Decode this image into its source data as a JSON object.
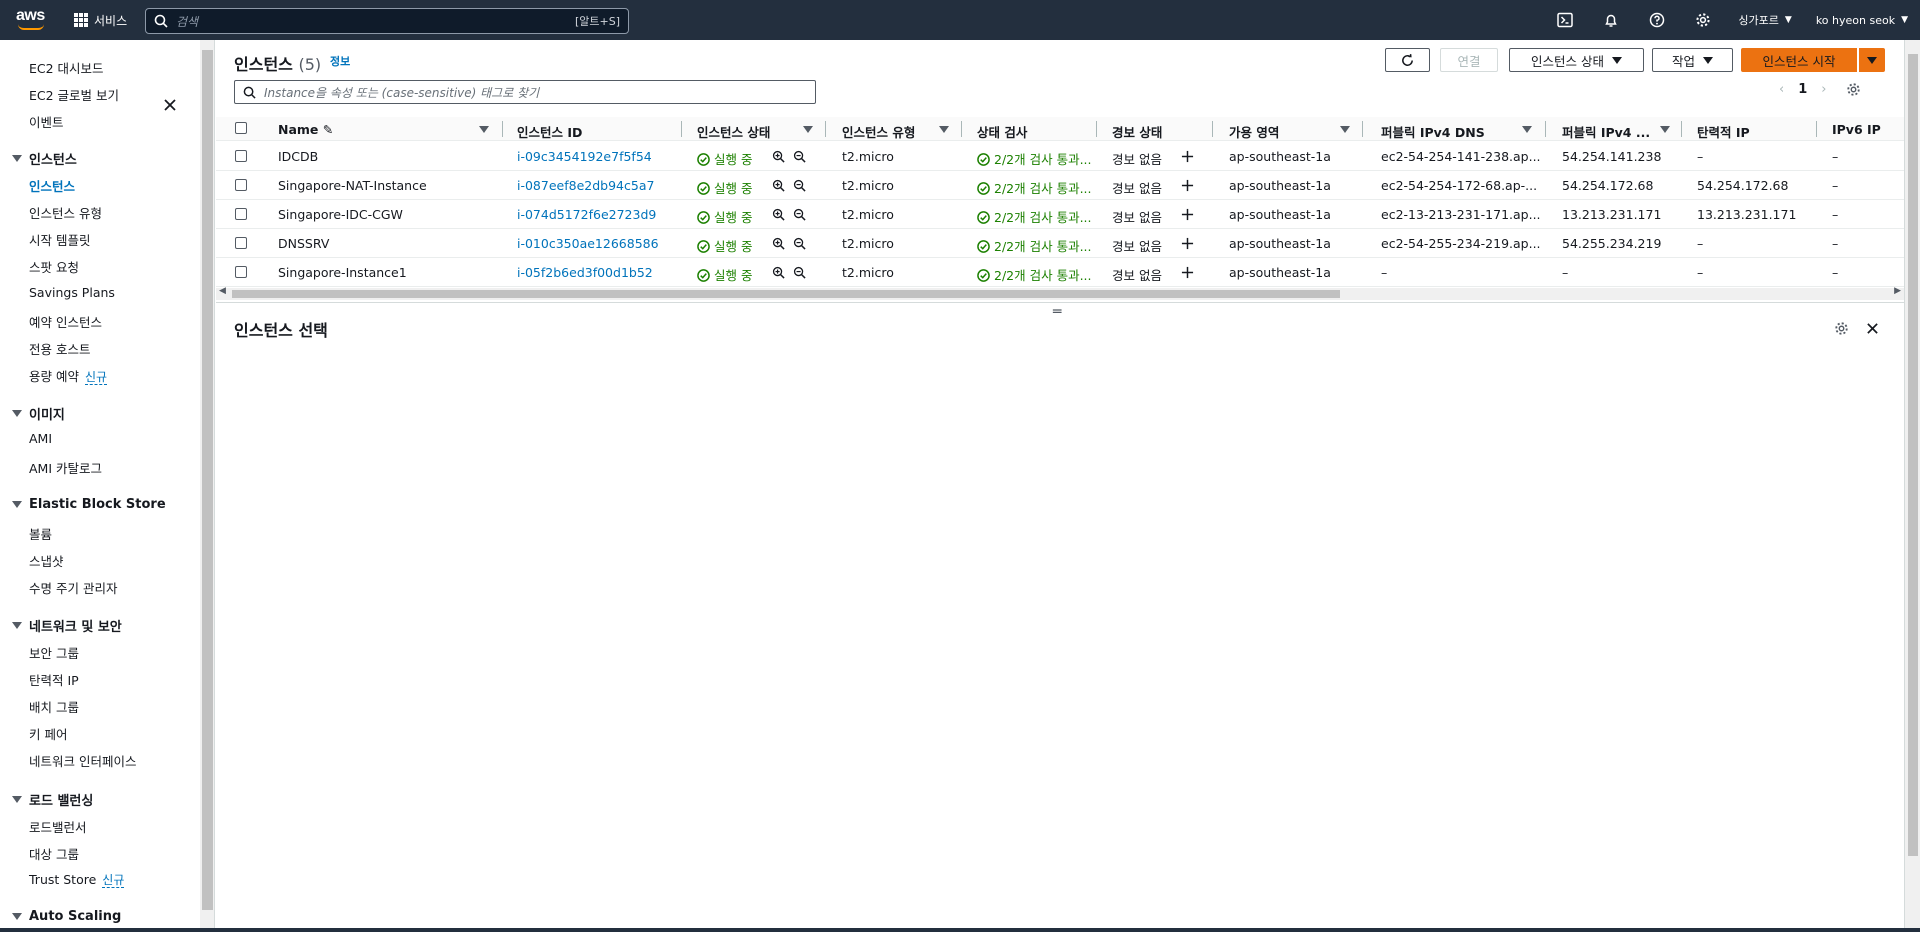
{
  "topnav": {
    "logo": "aws",
    "services_label": "서비스",
    "search_placeholder": "검색",
    "search_shortcut": "[알트+S]",
    "region": "싱가포르",
    "user": "ko hyeon seok",
    "icons": [
      "cloudshell-icon",
      "bell-icon",
      "help-icon",
      "gear-icon"
    ]
  },
  "sidebar": {
    "top_items": [
      "EC2 대시보드",
      "EC2 글로벌 보기",
      "이벤트"
    ],
    "sections": [
      {
        "title": "인스턴스",
        "items": [
          "인스턴스",
          "인스턴스 유형",
          "시작 템플릿",
          "스팟 요청",
          "Savings Plans",
          "예약 인스턴스",
          "전용 호스트",
          "용량 예약"
        ],
        "new_badge_on": "용량 예약"
      },
      {
        "title": "이미지",
        "items": [
          "AMI",
          "AMI 카탈로그"
        ]
      },
      {
        "title": "Elastic Block Store",
        "items": [
          "볼륨",
          "스냅샷",
          "수명 주기 관리자"
        ]
      },
      {
        "title": "네트워크 및 보안",
        "items": [
          "보안 그룹",
          "탄력적 IP",
          "배치 그룹",
          "키 페어",
          "네트워크 인터페이스"
        ]
      },
      {
        "title": "로드 밸런싱",
        "items": [
          "로드밸런서",
          "대상 그룹",
          "Trust Store"
        ],
        "new_badge_on": "Trust Store"
      },
      {
        "title": "Auto Scaling",
        "items": []
      }
    ],
    "new_label": "신규",
    "active_item": "인스턴스"
  },
  "header": {
    "title": "인스턴스",
    "count": "(5)",
    "info": "정보",
    "buttons": {
      "connect": "연결",
      "instance_state": "인스턴스 상태",
      "actions": "작업",
      "launch": "인스턴스 시작"
    },
    "filter_placeholder": "Instance을 속성 또는 (case-sensitive) 태그로 찾기",
    "page": "1"
  },
  "table": {
    "columns": [
      "Name",
      "인스턴스 ID",
      "인스턴스 상태",
      "인스턴스 유형",
      "상태 검사",
      "경보 상태",
      "가용 영역",
      "퍼블릭 IPv4 DNS",
      "퍼블릭 IPv4 ...",
      "탄력적 IP",
      "IPv6 IP"
    ],
    "rows": [
      {
        "name": "IDCDB",
        "id": "i-09c3454192e7f5f54",
        "state": "실행 중",
        "type": "t2.micro",
        "check": "2/2개 검사 통과...",
        "alarm": "경보 없음",
        "az": "ap-southeast-1a",
        "dns": "ec2-54-254-141-238.ap...",
        "ipv4": "54.254.141.238",
        "eip": "–",
        "ipv6": "–"
      },
      {
        "name": "Singapore-NAT-Instance",
        "id": "i-087eef8e2db94c5a7",
        "state": "실행 중",
        "type": "t2.micro",
        "check": "2/2개 검사 통과...",
        "alarm": "경보 없음",
        "az": "ap-southeast-1a",
        "dns": "ec2-54-254-172-68.ap-...",
        "ipv4": "54.254.172.68",
        "eip": "54.254.172.68",
        "ipv6": "–"
      },
      {
        "name": "Singapore-IDC-CGW",
        "id": "i-074d5172f6e2723d9",
        "state": "실행 중",
        "type": "t2.micro",
        "check": "2/2개 검사 통과...",
        "alarm": "경보 없음",
        "az": "ap-southeast-1a",
        "dns": "ec2-13-213-231-171.ap...",
        "ipv4": "13.213.231.171",
        "eip": "13.213.231.171",
        "ipv6": "–"
      },
      {
        "name": "DNSSRV",
        "id": "i-010c350ae12668586",
        "state": "실행 중",
        "type": "t2.micro",
        "check": "2/2개 검사 통과...",
        "alarm": "경보 없음",
        "az": "ap-southeast-1a",
        "dns": "ec2-54-255-234-219.ap...",
        "ipv4": "54.255.234.219",
        "eip": "–",
        "ipv6": "–"
      },
      {
        "name": "Singapore-Instance1",
        "id": "i-05f2b6ed3f00d1b52",
        "state": "실행 중",
        "type": "t2.micro",
        "check": "2/2개 검사 통과...",
        "alarm": "경보 없음",
        "az": "ap-southeast-1a",
        "dns": "–",
        "ipv4": "–",
        "eip": "–",
        "ipv6": "–"
      }
    ]
  },
  "detail": {
    "title": "인스턴스 선택"
  },
  "colors": {
    "nav": "#232f3e",
    "accent": "#ec7211",
    "link": "#0073bb",
    "ok": "#1d8102"
  }
}
